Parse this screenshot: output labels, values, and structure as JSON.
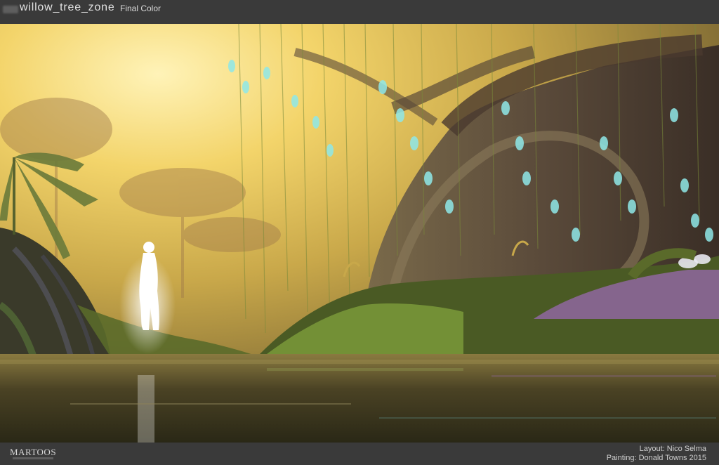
{
  "header": {
    "title": "willow_tree_zone",
    "subtitle": "Final Color"
  },
  "footer": {
    "studio": "MARTOOS",
    "layout_credit": "Layout: Nico Selma",
    "painting_credit": "Painting: Donald Towns  2015"
  },
  "artwork": {
    "colors": {
      "sky_glow": "#f4d67a",
      "haze": "#c8b070",
      "tree_trunk": "#6a5a4a",
      "foliage": "#6d8a3a",
      "petals": "#7fe0e8",
      "flowers": "#a070b8",
      "water": "#3a3a24"
    }
  }
}
